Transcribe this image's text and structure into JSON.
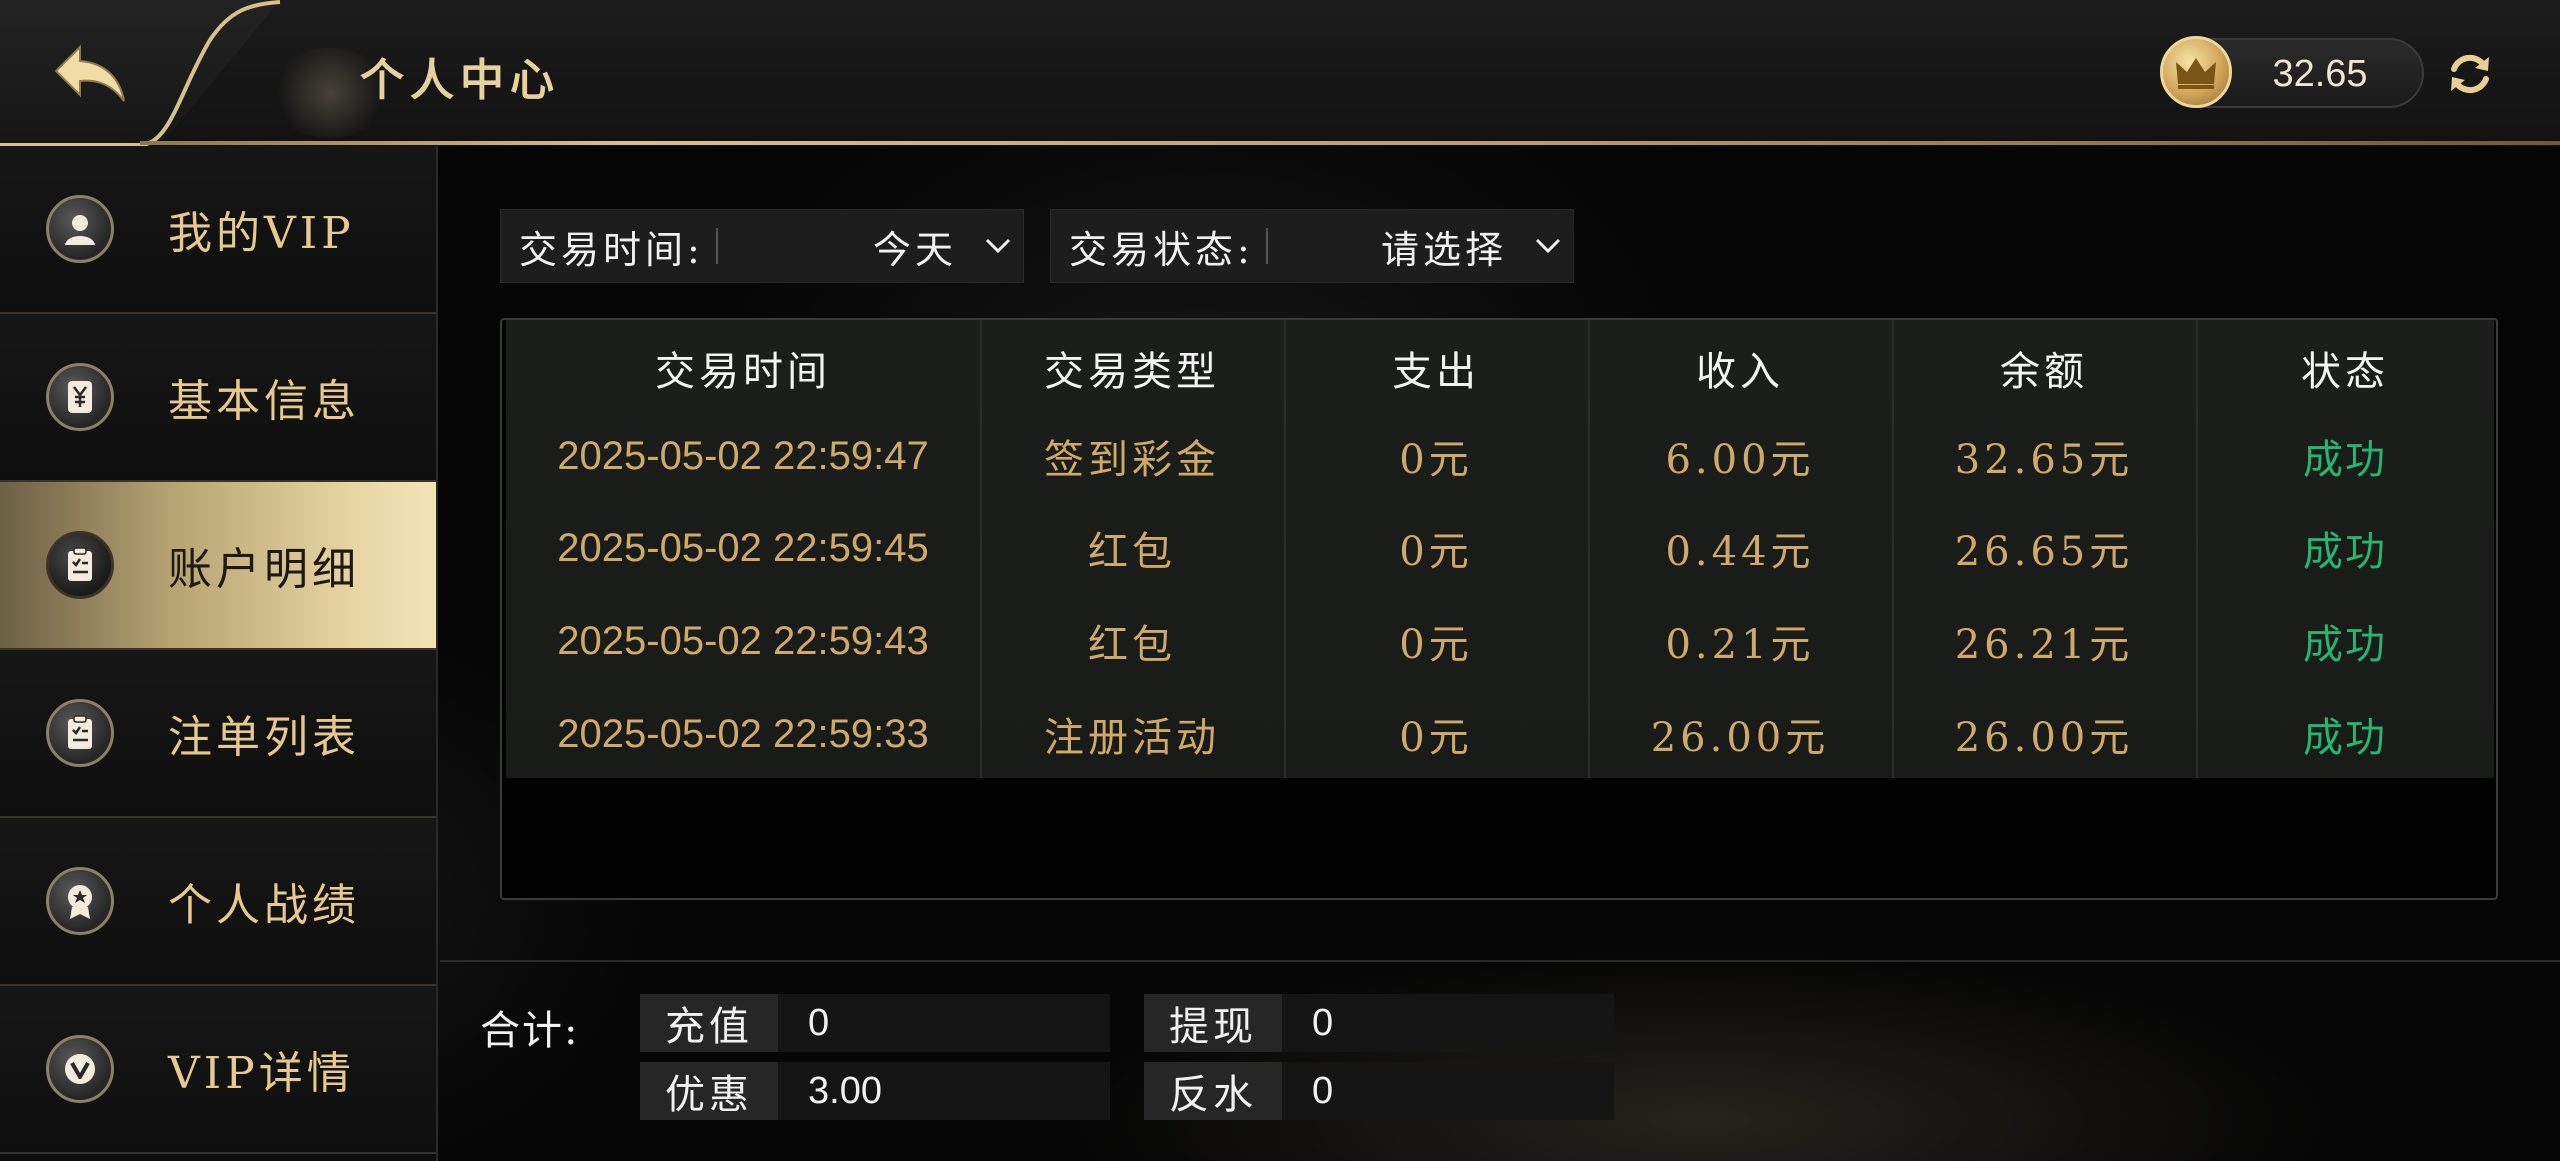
{
  "header": {
    "title": "个人中心",
    "balance": "32.65",
    "icons": {
      "back": "back-arrow-icon",
      "coin": "crown-coin-icon",
      "refresh": "refresh-icon"
    }
  },
  "sidebar": {
    "items": [
      {
        "label": "我的VIP",
        "icon": "user-icon",
        "active": false
      },
      {
        "label": "基本信息",
        "icon": "yuan-card-icon",
        "active": false
      },
      {
        "label": "账户明细",
        "icon": "clipboard-icon",
        "active": true
      },
      {
        "label": "注单列表",
        "icon": "clipboard-icon",
        "active": false
      },
      {
        "label": "个人战绩",
        "icon": "medal-icon",
        "active": false
      },
      {
        "label": "VIP详情",
        "icon": "vip-badge-icon",
        "active": false
      }
    ]
  },
  "filters": {
    "time": {
      "label": "交易时间:",
      "value": "今天"
    },
    "status": {
      "label": "交易状态:",
      "value": "请选择"
    }
  },
  "table": {
    "columns": [
      "交易时间",
      "交易类型",
      "支出",
      "收入",
      "余额",
      "状态"
    ],
    "rows": [
      {
        "time": "2025-05-02 22:59:47",
        "type": "签到彩金",
        "out": "0元",
        "in": "6.00元",
        "balance": "32.65元",
        "status": "成功"
      },
      {
        "time": "2025-05-02 22:59:45",
        "type": "红包",
        "out": "0元",
        "in": "0.44元",
        "balance": "26.65元",
        "status": "成功"
      },
      {
        "time": "2025-05-02 22:59:43",
        "type": "红包",
        "out": "0元",
        "in": "0.21元",
        "balance": "26.21元",
        "status": "成功"
      },
      {
        "time": "2025-05-02 22:59:33",
        "type": "注册活动",
        "out": "0元",
        "in": "26.00元",
        "balance": "26.00元",
        "status": "成功"
      }
    ]
  },
  "summary": {
    "label": "合计:",
    "recharge": {
      "key": "充值",
      "value": "0"
    },
    "withdraw": {
      "key": "提现",
      "value": "0"
    },
    "discount": {
      "key": "优惠",
      "value": "3.00"
    },
    "rebate": {
      "key": "反水",
      "value": "0"
    }
  },
  "colors": {
    "gold": "#e6c98e",
    "success": "#27b572",
    "accent_line": "#d6c08c"
  }
}
